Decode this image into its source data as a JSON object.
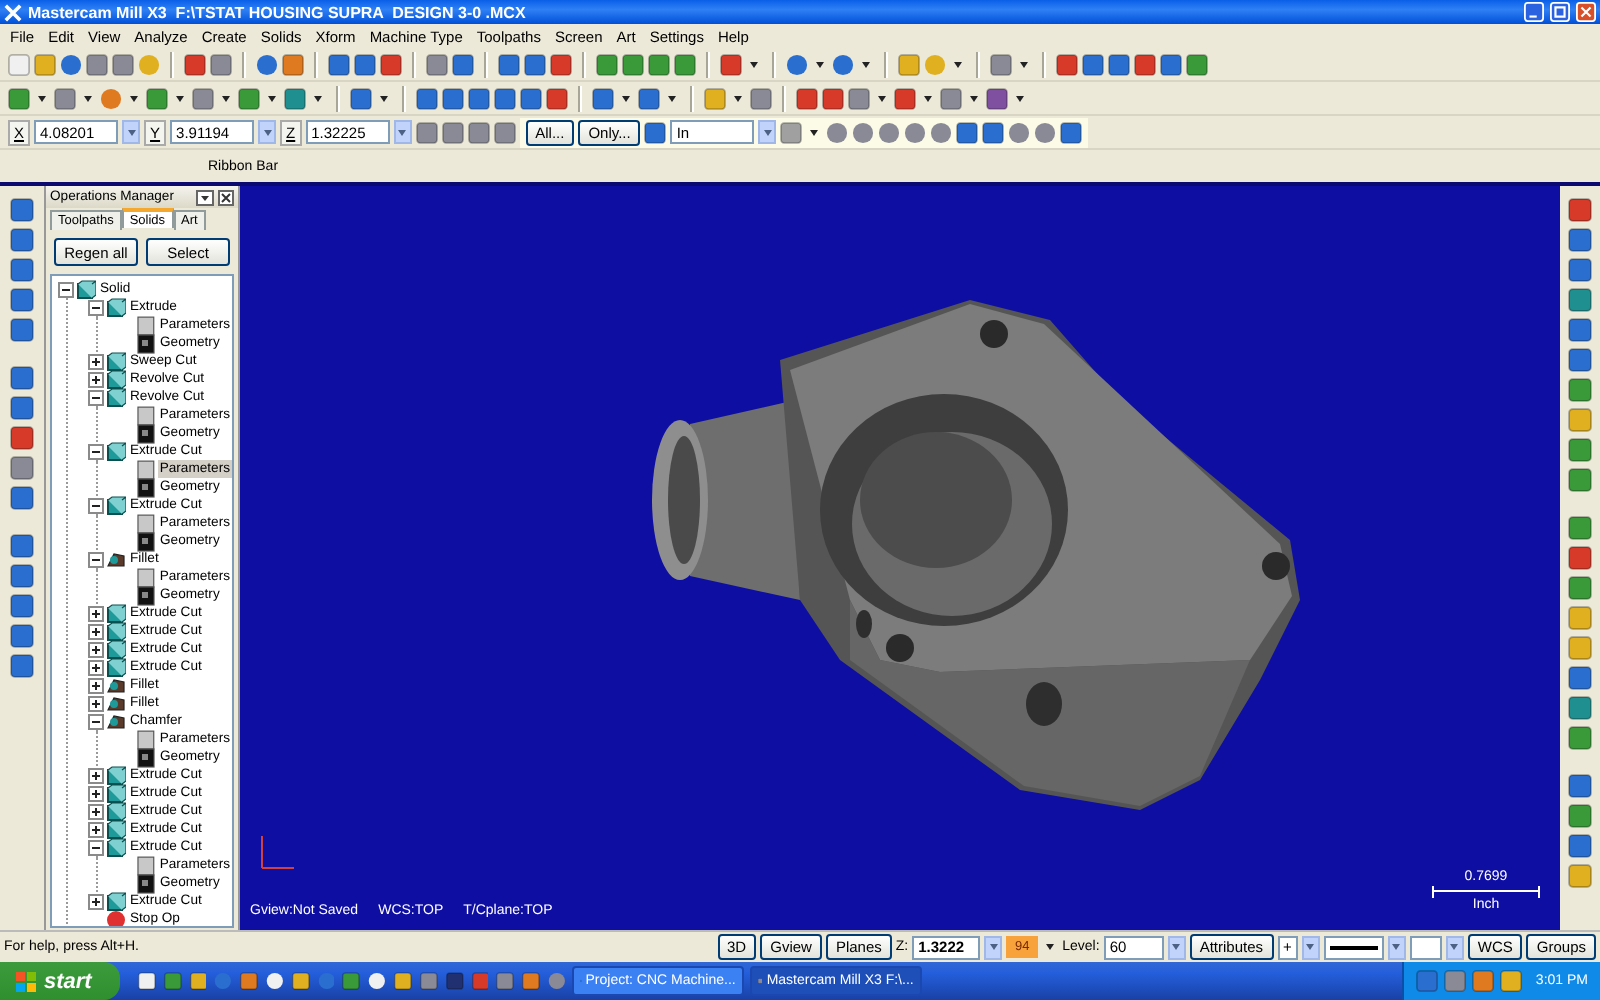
{
  "window": {
    "title": "Mastercam Mill X3  F:\\TSTAT HOUSING SUPRA  DESIGN 3-0 .MCX"
  },
  "menu": [
    "File",
    "Edit",
    "View",
    "Analyze",
    "Create",
    "Solids",
    "Xform",
    "Machine Type",
    "Toolpaths",
    "Screen",
    "Art",
    "Settings",
    "Help"
  ],
  "coordinates": [
    {
      "axis": "X",
      "value": "4.08201"
    },
    {
      "axis": "Y",
      "value": "3.91194"
    },
    {
      "axis": "Z",
      "value": "1.32225"
    }
  ],
  "ribbon_buttons": [
    "All...",
    "Only..."
  ],
  "mask_select": {
    "value": "In"
  },
  "ribbon_bar": {
    "label": "Ribbon Bar"
  },
  "operations_manager": {
    "title": "Operations Manager",
    "tabs": [
      {
        "label": "Toolpaths",
        "selected": false
      },
      {
        "label": "Solids",
        "selected": true
      },
      {
        "label": "Art",
        "selected": false
      }
    ],
    "buttons": [
      "Regen all",
      "Select"
    ],
    "tree": [
      {
        "label": "Solid",
        "kind": "solid",
        "expanded": true,
        "selected": false,
        "children": [
          {
            "label": "Extrude",
            "kind": "feature",
            "expanded": true,
            "selected": false,
            "children": [
              {
                "label": "Parameters",
                "kind": "parameters",
                "selected": false
              },
              {
                "label": "Geometry",
                "kind": "geometry",
                "selected": false
              }
            ]
          },
          {
            "label": "Sweep Cut",
            "kind": "feature",
            "expanded": false,
            "selected": false
          },
          {
            "label": "Revolve Cut",
            "kind": "feature",
            "expanded": false,
            "selected": false
          },
          {
            "label": "Revolve Cut",
            "kind": "feature",
            "expanded": true,
            "selected": false,
            "children": [
              {
                "label": "Parameters",
                "kind": "parameters",
                "selected": false
              },
              {
                "label": "Geometry",
                "kind": "geometry",
                "selected": false
              }
            ]
          },
          {
            "label": "Extrude Cut",
            "kind": "feature",
            "expanded": true,
            "selected": false,
            "children": [
              {
                "label": "Parameters",
                "kind": "parameters",
                "selected": true
              },
              {
                "label": "Geometry",
                "kind": "geometry",
                "selected": false
              }
            ]
          },
          {
            "label": "Extrude Cut",
            "kind": "feature",
            "expanded": true,
            "selected": false,
            "children": [
              {
                "label": "Parameters",
                "kind": "parameters",
                "selected": false
              },
              {
                "label": "Geometry",
                "kind": "geometry",
                "selected": false
              }
            ]
          },
          {
            "label": "Fillet",
            "kind": "fillet",
            "expanded": true,
            "selected": false,
            "children": [
              {
                "label": "Parameters",
                "kind": "parameters",
                "selected": false
              },
              {
                "label": "Geometry",
                "kind": "geometry",
                "selected": false
              }
            ]
          },
          {
            "label": "Extrude Cut",
            "kind": "feature",
            "expanded": false,
            "selected": false
          },
          {
            "label": "Extrude Cut",
            "kind": "feature",
            "expanded": false,
            "selected": false
          },
          {
            "label": "Extrude Cut",
            "kind": "feature",
            "expanded": false,
            "selected": false
          },
          {
            "label": "Extrude Cut",
            "kind": "feature",
            "expanded": false,
            "selected": false
          },
          {
            "label": "Fillet",
            "kind": "fillet",
            "expanded": false,
            "selected": false
          },
          {
            "label": "Fillet",
            "kind": "fillet",
            "expanded": false,
            "selected": false
          },
          {
            "label": "Chamfer",
            "kind": "fillet",
            "expanded": true,
            "selected": false,
            "children": [
              {
                "label": "Parameters",
                "kind": "parameters",
                "selected": false
              },
              {
                "label": "Geometry",
                "kind": "geometry",
                "selected": false
              }
            ]
          },
          {
            "label": "Extrude Cut",
            "kind": "feature",
            "expanded": false,
            "selected": false
          },
          {
            "label": "Extrude Cut",
            "kind": "feature",
            "expanded": false,
            "selected": false
          },
          {
            "label": "Extrude Cut",
            "kind": "feature",
            "expanded": false,
            "selected": false
          },
          {
            "label": "Extrude Cut",
            "kind": "feature",
            "expanded": false,
            "selected": false
          },
          {
            "label": "Extrude Cut",
            "kind": "feature",
            "expanded": true,
            "selected": false,
            "children": [
              {
                "label": "Parameters",
                "kind": "parameters",
                "selected": false
              },
              {
                "label": "Geometry",
                "kind": "geometry",
                "selected": false
              }
            ]
          },
          {
            "label": "Extrude Cut",
            "kind": "feature",
            "expanded": false,
            "selected": false
          },
          {
            "label": "Stop Op",
            "kind": "stop",
            "selected": false
          }
        ]
      }
    ]
  },
  "viewport": {
    "gview": "Gview:Not Saved",
    "wcs": "WCS:TOP",
    "tcplane": "T/Cplane:TOP",
    "scale_value": "0.7699",
    "scale_unit": "Inch"
  },
  "status_bar": {
    "help": "For help, press Alt+H.",
    "buttons": [
      "3D",
      "Gview",
      "Planes"
    ],
    "z_label": "Z:",
    "z_value": "1.3222",
    "color_number": "94",
    "level_label": "Level:",
    "level_value": "60",
    "attributes": "Attributes",
    "point_style": "+",
    "right_buttons": [
      "WCS",
      "Groups"
    ]
  },
  "taskbar": {
    "start": "start",
    "tasks": [
      {
        "label": "Project: CNC Machine...",
        "selected": false
      },
      {
        "label": "Mastercam Mill X3  F:\\...",
        "selected": true
      }
    ],
    "clock": "3:01 PM"
  }
}
